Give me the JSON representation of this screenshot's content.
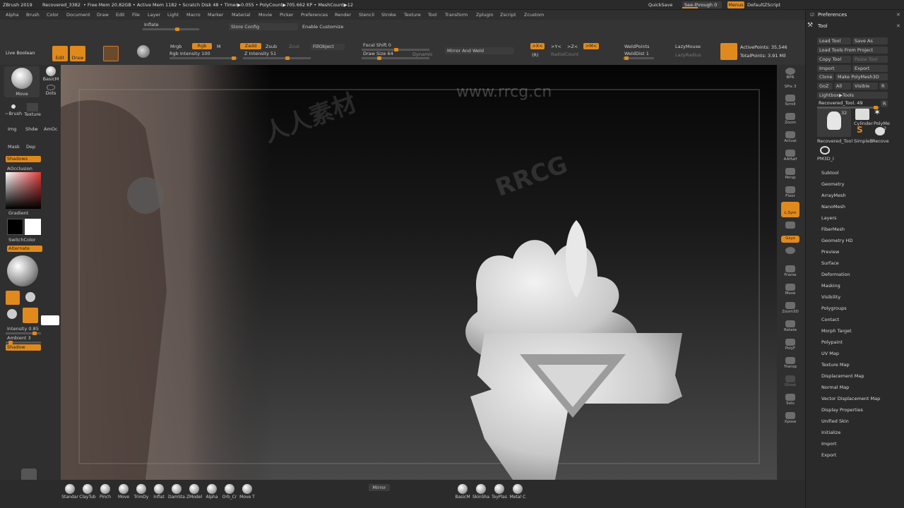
{
  "topbar": {
    "app": "ZBrush 2019",
    "doc": "Recovered_3382",
    "stats": "• Free Mem 20.82GB • Active Mem 1182 • Scratch Disk 48 • Timer▶0.055 • PolyCount▶705.662 KP • MeshCount▶12",
    "quicksave": "QuickSave",
    "seethrough": "See-through 0",
    "menus": "Menus",
    "script": "DefaultZScript"
  },
  "menubar": [
    "Alpha",
    "Brush",
    "Color",
    "Document",
    "Draw",
    "Edit",
    "File",
    "Layer",
    "Light",
    "Macro",
    "Marker",
    "Material",
    "Movie",
    "Picker",
    "Preferences",
    "Render",
    "Stencil",
    "Stroke",
    "Texture",
    "Tool",
    "Transform",
    "Zplugin",
    "Zscript",
    "Zcustom"
  ],
  "shelf": {
    "inflate": "Inflate",
    "store_config": "Store Config",
    "enable_customize": "Enable Customize",
    "live_boolean": "Live Boolean",
    "edit": "Edit",
    "draw": "Draw",
    "mrgb": "Mrgb",
    "rgb": "Rgb",
    "m": "M",
    "rgb_intensity": "Rgb Intensity 100",
    "zadd": "Zadd",
    "zsub": "Zsub",
    "zcut": "Zcut",
    "z_intensity": "Z Intensity 51",
    "fill_object": "FillObject",
    "focal_shift": "Focal Shift 0",
    "draw_size": "Draw Size 64",
    "dynamic": "Dynamic",
    "mirror_weld": "Mirror And Weld",
    "x": ">X<",
    "y": ">Y<",
    "z": ">Z<",
    "m2": ">M<",
    "r": "(R)",
    "radial_count": "RadialCount",
    "weld_points": "WeldPoints",
    "weld_dist": "WeldDist 1",
    "lazy_mouse": "LazyMouse",
    "lazy_radius": "LazyRadius",
    "active_points": "ActivePoints: 35,546",
    "total_points": "TotalPoints: 3.91 Mil"
  },
  "left": {
    "move": "Move",
    "basicm": "BasicM",
    "dots": "Dots",
    "brush": "~Brush",
    "texture": "Texture",
    "img": "Img",
    "shdw": "Shdw",
    "amoc": "AmOc",
    "mask": "Mask",
    "dep": "Dep",
    "shadows": "Shadows",
    "aocclusion": "AOcclusion",
    "gradient": "Gradient",
    "switchcolor": "SwitchColor",
    "alternate": "Alternate",
    "intensity": "Intensity 0.85",
    "ambient": "Ambient 3",
    "shadow": "Shadow"
  },
  "right_tray": [
    "BPR",
    "SPix 3",
    "Scroll",
    "Zoom",
    "Actual",
    "AAHalf",
    "Persp",
    "Floor",
    "L.Sym",
    "Gxyz",
    "",
    "Frame",
    "Move",
    "Zoom3D",
    "Rotate",
    "PolyF",
    "Transp",
    "Ghost",
    "Solo",
    "Xpose"
  ],
  "panel": {
    "preferences": "Preferences",
    "tool": "Tool",
    "load_tool": "Load Tool",
    "save_as": "Save As",
    "load_from_project": "Load Tools From Project",
    "copy_tool": "Copy Tool",
    "paste_tool": "Paste Tool",
    "import": "Import",
    "export": "Export",
    "clone": "Clone",
    "make_polymesh": "Make PolyMesh3D",
    "goz": "GoZ",
    "all": "All",
    "visible": "Visible",
    "r": "R",
    "lightbox_tools": "Lightbox▶Tools",
    "recovered_tool": "Recovered_Tool. 49",
    "thumb_count": "32",
    "thumb_count2": "2",
    "thumb_labels": [
      "Recovered_Tool",
      "Cylinder",
      "PolyMe",
      "SimpleB",
      "Recove",
      "PM3D_I"
    ],
    "items": [
      "Subtool",
      "Geometry",
      "ArrayMesh",
      "NanoMesh",
      "Layers",
      "FiberMesh",
      "Geometry HD",
      "Preview",
      "Surface",
      "Deformation",
      "Masking",
      "Visibility",
      "Polygroups",
      "Contact",
      "Morph Target",
      "Polypaint",
      "UV Map",
      "Texture Map",
      "Displacement Map",
      "Normal Map",
      "Vector Displacement Map",
      "Display Properties",
      "Unified Skin",
      "Initialize",
      "Import",
      "Export"
    ]
  },
  "bottom": {
    "brushes_left": [
      "Standar",
      "ClayTub",
      "Pinch",
      "Move",
      "TrimDy",
      "Inflat",
      "DamSta",
      "ZModel",
      "Alpha",
      "Orb_Cr",
      "Move T"
    ],
    "mirror": "Mirror",
    "brushes_right": [
      "BasicM",
      "SkinSha",
      "ToyPlas",
      "Metal C"
    ]
  },
  "watermarks": [
    "www.rrcg.cn",
    "RRCG",
    "人人素材"
  ]
}
